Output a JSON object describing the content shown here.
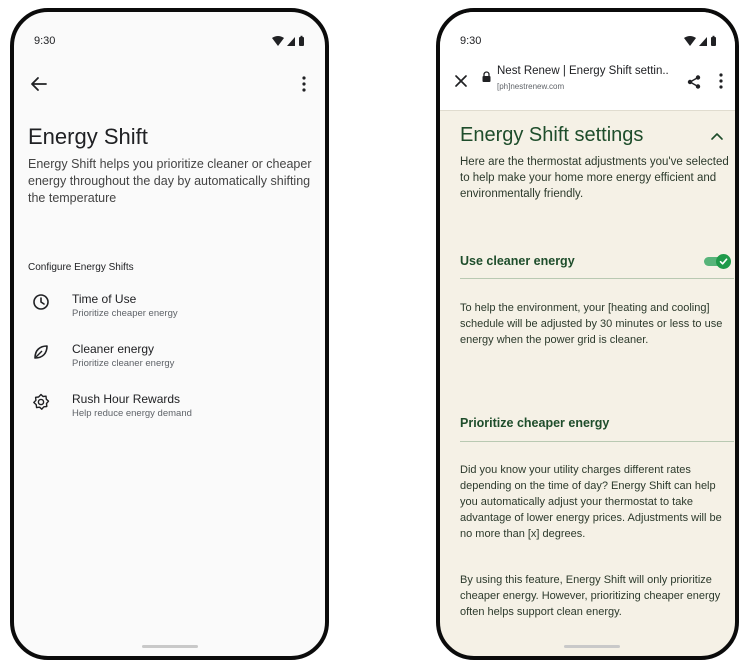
{
  "left_phone": {
    "status": {
      "time": "9:30"
    },
    "icons": {
      "back": "arrow-left-icon",
      "more": "more-vert-icon"
    },
    "title": "Energy Shift",
    "description": "Energy Shift helps you prioritize cleaner or cheaper energy throughout the day by automatically shifting the temperature",
    "section_label": "Configure Energy Shifts",
    "options": [
      {
        "icon": "clock-icon",
        "title": "Time of Use",
        "subtitle": "Prioritize cheaper energy"
      },
      {
        "icon": "leaf-icon",
        "title": "Cleaner energy",
        "subtitle": "Prioritize cleaner energy"
      },
      {
        "icon": "gear-icon",
        "title": "Rush Hour Rewards",
        "subtitle": "Help reduce energy demand"
      }
    ]
  },
  "right_phone": {
    "status": {
      "time": "9:30"
    },
    "browser": {
      "title": "Nest Renew | Energy Shift settin..",
      "url": "[ph]nestrenew.com"
    },
    "title": "Energy Shift settings",
    "intro": "Here are the thermostat adjustments you've selected to help make your home more energy efficient and environmentally friendly.",
    "cleaner": {
      "heading": "Use cleaner energy",
      "toggle_on": true,
      "body": "To help the environment, your [heating and cooling] schedule will be adjusted by 30 minutes or less to use energy when the power grid is cleaner."
    },
    "cheaper": {
      "heading": "Prioritize cheaper energy",
      "body": "Did you know your utility charges different rates depending on the time of day? Energy Shift can help you automatically adjust your thermostat to take advantage of lower energy prices. Adjustments will be no more than [x] degrees.",
      "body2": "By using this feature, Energy Shift will only prioritize cheaper energy. However, prioritizing cheaper energy often helps support clean energy."
    }
  },
  "colors": {
    "accent_green": "#1f9a4a",
    "heading_green": "#1e4d2b",
    "sheet_bg": "#f5f1e6"
  }
}
